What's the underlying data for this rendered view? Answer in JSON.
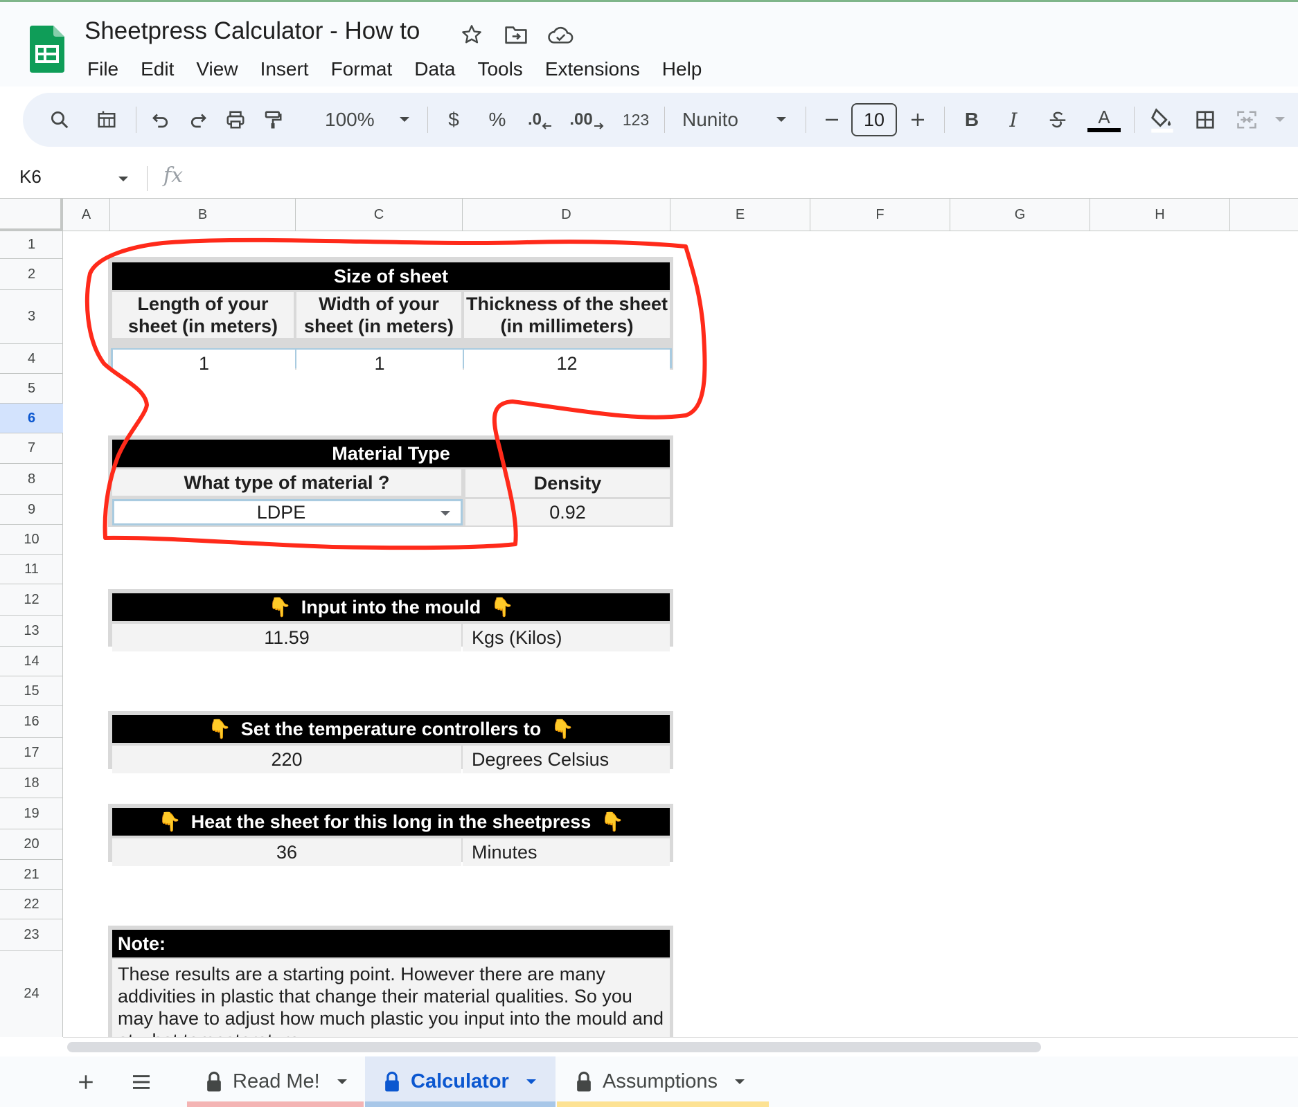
{
  "app": {
    "title": "Sheetpress Calculator - How to",
    "menu": [
      "File",
      "Edit",
      "View",
      "Insert",
      "Format",
      "Data",
      "Tools",
      "Extensions",
      "Help"
    ]
  },
  "toolbar": {
    "zoom": "100%",
    "currency": "$",
    "percent": "%",
    "decrease_decimal": ".0",
    "increase_decimal": ".00",
    "number_format": "123",
    "font": "Nunito",
    "font_size": "10",
    "bold": "B",
    "italic": "I",
    "text_color_label": "A"
  },
  "formula_bar": {
    "cell_ref": "K6",
    "fx": "fx",
    "value": ""
  },
  "grid": {
    "columns": [
      "A",
      "B",
      "C",
      "D",
      "E",
      "F",
      "G",
      "H"
    ],
    "rows": [
      "1",
      "2",
      "3",
      "4",
      "5",
      "6",
      "7",
      "8",
      "9",
      "10",
      "11",
      "12",
      "13",
      "14",
      "15",
      "16",
      "17",
      "18",
      "19",
      "20",
      "21",
      "22",
      "23",
      "24"
    ],
    "selected_row": "6"
  },
  "size_block": {
    "title": "Size of sheet",
    "length_label": "Length of your sheet (in meters)",
    "width_label": "Width of your sheet (in meters)",
    "thickness_label": "Thickness of the sheet (in millimeters)",
    "length": "1",
    "width": "1",
    "thickness": "12"
  },
  "material_block": {
    "title": "Material Type",
    "question": "What type of material ?",
    "density_label": "Density",
    "material": "LDPE",
    "density": "0.92"
  },
  "mould_block": {
    "title": "Input into the mould",
    "value": "11.59",
    "unit": "Kgs (Kilos)"
  },
  "temperature_block": {
    "title": "Set the temperature controllers to",
    "value": "220",
    "unit": "Degrees Celsius"
  },
  "heat_block": {
    "title": "Heat the sheet for this long in the sheetpress",
    "value": "36",
    "unit": "Minutes"
  },
  "note_block": {
    "title": "Note:",
    "text": "These results are a starting point. However there are many addivities in plastic that change their material qualities. So you may have to adjust how much plastic you input into the mould and at what tempatarature"
  },
  "sheet_tabs": [
    {
      "label": "Read Me!",
      "color": "#f4b4b4"
    },
    {
      "label": "Calculator",
      "color": "#a8c7e8"
    },
    {
      "label": "Assumptions",
      "color": "#fde293"
    }
  ],
  "colors": {
    "accent": "#0b57d0",
    "sheets_green": "#0f9d58",
    "annotation": "#ff2a1a"
  }
}
